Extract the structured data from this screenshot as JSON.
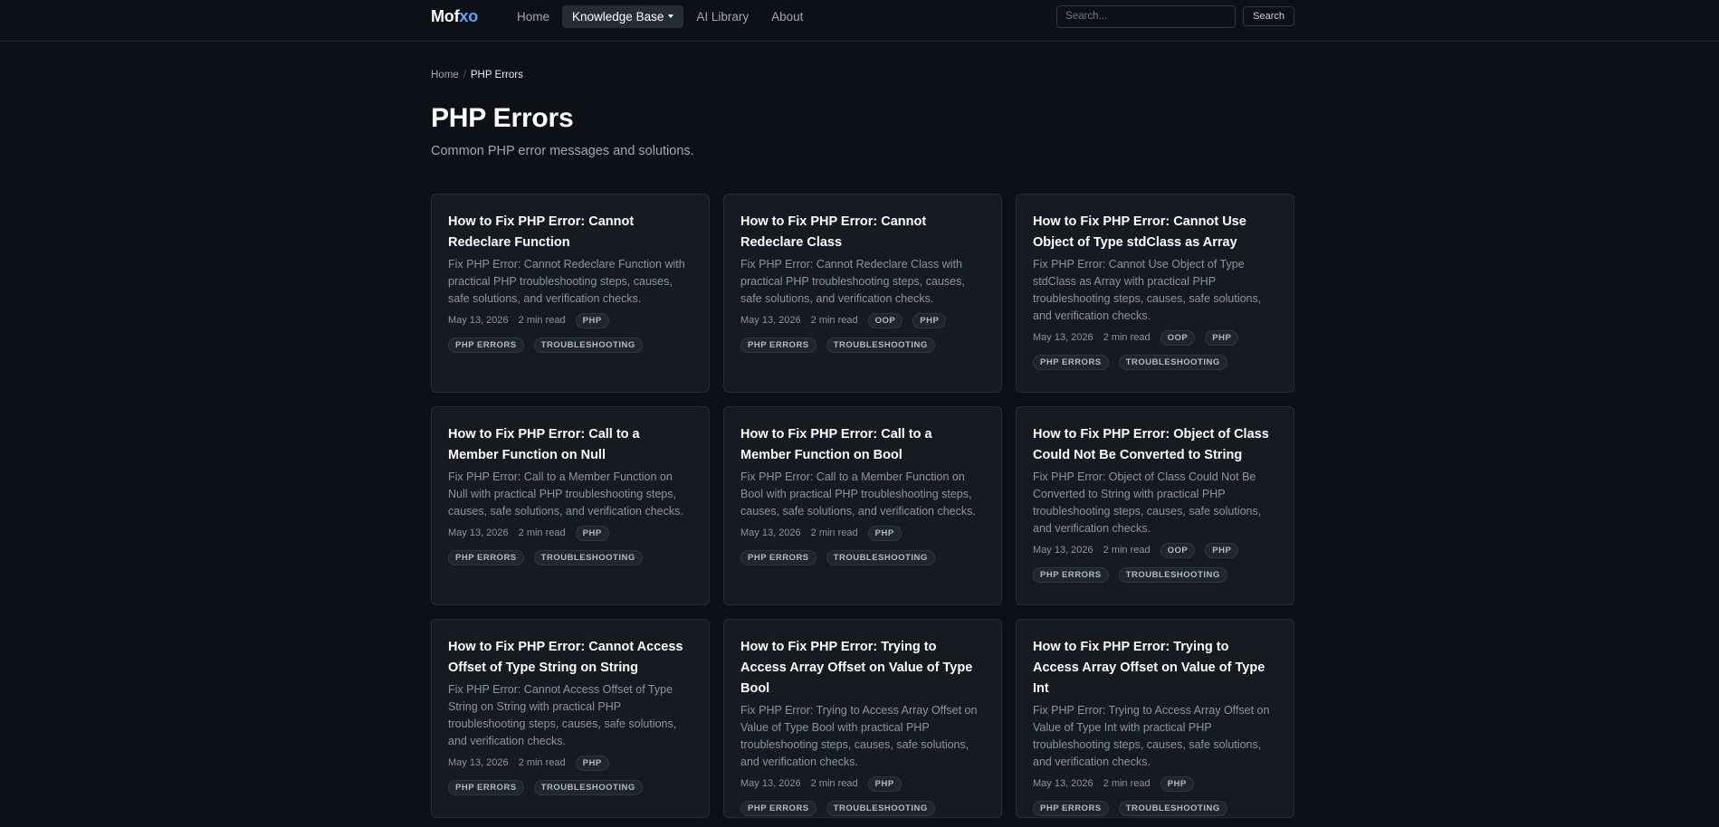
{
  "header": {
    "brand_part1": "Mof",
    "brand_part2": "xo",
    "nav": [
      {
        "label": "Home"
      },
      {
        "label": "Knowledge Base"
      },
      {
        "label": "AI Library"
      },
      {
        "label": "About"
      }
    ],
    "search_placeholder": "Search...",
    "search_button": "Search"
  },
  "breadcrumb": {
    "home": "Home",
    "separator": "/",
    "current": "PHP Errors"
  },
  "page": {
    "title": "PHP Errors",
    "subtitle": "Common PHP error messages and solutions."
  },
  "articles": [
    {
      "title": "How to Fix PHP Error: Cannot Redeclare Function",
      "description": "Fix PHP Error: Cannot Redeclare Function with practical PHP troubleshooting steps, causes, safe solutions, and verification checks.",
      "date": "May 13, 2026",
      "read_time": "2 min read",
      "tags": [
        "PHP",
        "PHP ERRORS",
        "TROUBLESHOOTING"
      ]
    },
    {
      "title": "How to Fix PHP Error: Cannot Redeclare Class",
      "description": "Fix PHP Error: Cannot Redeclare Class with practical PHP troubleshooting steps, causes, safe solutions, and verification checks.",
      "date": "May 13, 2026",
      "read_time": "2 min read",
      "tags": [
        "OOP",
        "PHP",
        "PHP ERRORS",
        "TROUBLESHOOTING"
      ]
    },
    {
      "title": "How to Fix PHP Error: Cannot Use Object of Type stdClass as Array",
      "description": "Fix PHP Error: Cannot Use Object of Type stdClass as Array with practical PHP troubleshooting steps, causes, safe solutions, and verification checks.",
      "date": "May 13, 2026",
      "read_time": "2 min read",
      "tags": [
        "OOP",
        "PHP",
        "PHP ERRORS",
        "TROUBLESHOOTING"
      ]
    },
    {
      "title": "How to Fix PHP Error: Call to a Member Function on Null",
      "description": "Fix PHP Error: Call to a Member Function on Null with practical PHP troubleshooting steps, causes, safe solutions, and verification checks.",
      "date": "May 13, 2026",
      "read_time": "2 min read",
      "tags": [
        "PHP",
        "PHP ERRORS",
        "TROUBLESHOOTING"
      ]
    },
    {
      "title": "How to Fix PHP Error: Call to a Member Function on Bool",
      "description": "Fix PHP Error: Call to a Member Function on Bool with practical PHP troubleshooting steps, causes, safe solutions, and verification checks.",
      "date": "May 13, 2026",
      "read_time": "2 min read",
      "tags": [
        "PHP",
        "PHP ERRORS",
        "TROUBLESHOOTING"
      ]
    },
    {
      "title": "How to Fix PHP Error: Object of Class Could Not Be Converted to String",
      "description": "Fix PHP Error: Object of Class Could Not Be Converted to String with practical PHP troubleshooting steps, causes, safe solutions, and verification checks.",
      "date": "May 13, 2026",
      "read_time": "2 min read",
      "tags": [
        "OOP",
        "PHP",
        "PHP ERRORS",
        "TROUBLESHOOTING"
      ]
    },
    {
      "title": "How to Fix PHP Error: Cannot Access Offset of Type String on String",
      "description": "Fix PHP Error: Cannot Access Offset of Type String on String with practical PHP troubleshooting steps, causes, safe solutions, and verification checks.",
      "date": "May 13, 2026",
      "read_time": "2 min read",
      "tags": [
        "PHP",
        "PHP ERRORS",
        "TROUBLESHOOTING"
      ]
    },
    {
      "title": "How to Fix PHP Error: Trying to Access Array Offset on Value of Type Bool",
      "description": "Fix PHP Error: Trying to Access Array Offset on Value of Type Bool with practical PHP troubleshooting steps, causes, safe solutions, and verification checks.",
      "date": "May 13, 2026",
      "read_time": "2 min read",
      "tags": [
        "PHP",
        "PHP ERRORS",
        "TROUBLESHOOTING"
      ]
    },
    {
      "title": "How to Fix PHP Error: Trying to Access Array Offset on Value of Type Int",
      "description": "Fix PHP Error: Trying to Access Array Offset on Value of Type Int with practical PHP troubleshooting steps, causes, safe solutions, and verification checks.",
      "date": "May 13, 2026",
      "read_time": "2 min read",
      "tags": [
        "PHP",
        "PHP ERRORS",
        "TROUBLESHOOTING"
      ]
    }
  ]
}
